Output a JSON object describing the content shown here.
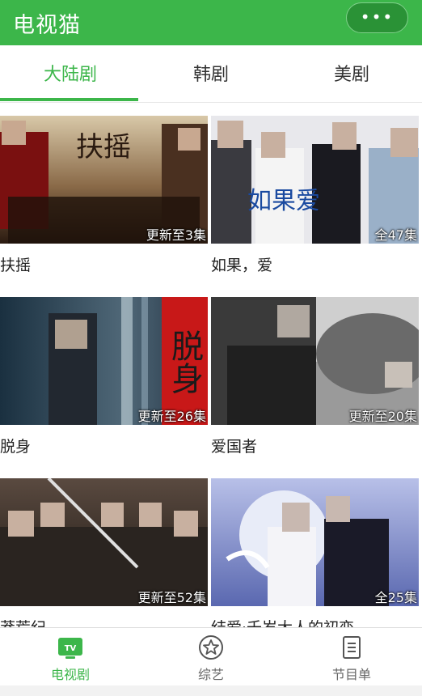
{
  "app": {
    "title": "电视猫",
    "more_label": "•••"
  },
  "tabs": [
    {
      "label": "大陆剧",
      "active": true
    },
    {
      "label": "韩剧",
      "active": false
    },
    {
      "label": "美剧",
      "active": false
    }
  ],
  "shows": [
    {
      "title": "扶摇",
      "badge": "更新至3集",
      "poster_text": "扶摇"
    },
    {
      "title": "如果，爱",
      "badge": "全47集",
      "poster_text": "如果爱"
    },
    {
      "title": "脱身",
      "badge": "更新至26集",
      "poster_text": "脱身"
    },
    {
      "title": "爱国者",
      "badge": "更新至20集",
      "poster_text": ""
    },
    {
      "title": "莽荒纪",
      "badge": "更新至52集",
      "poster_text": ""
    },
    {
      "title": "结爱·千岁大人的初恋",
      "badge": "全25集",
      "poster_text": ""
    }
  ],
  "bottom_nav": [
    {
      "label": "电视剧",
      "icon": "tv-icon",
      "icon_text": "TV",
      "active": true
    },
    {
      "label": "综艺",
      "icon": "star-icon",
      "active": false
    },
    {
      "label": "节目单",
      "icon": "list-icon",
      "active": false
    }
  ],
  "colors": {
    "brand": "#3cb64a",
    "brand_dark": "#2a9236",
    "text": "#222222"
  }
}
